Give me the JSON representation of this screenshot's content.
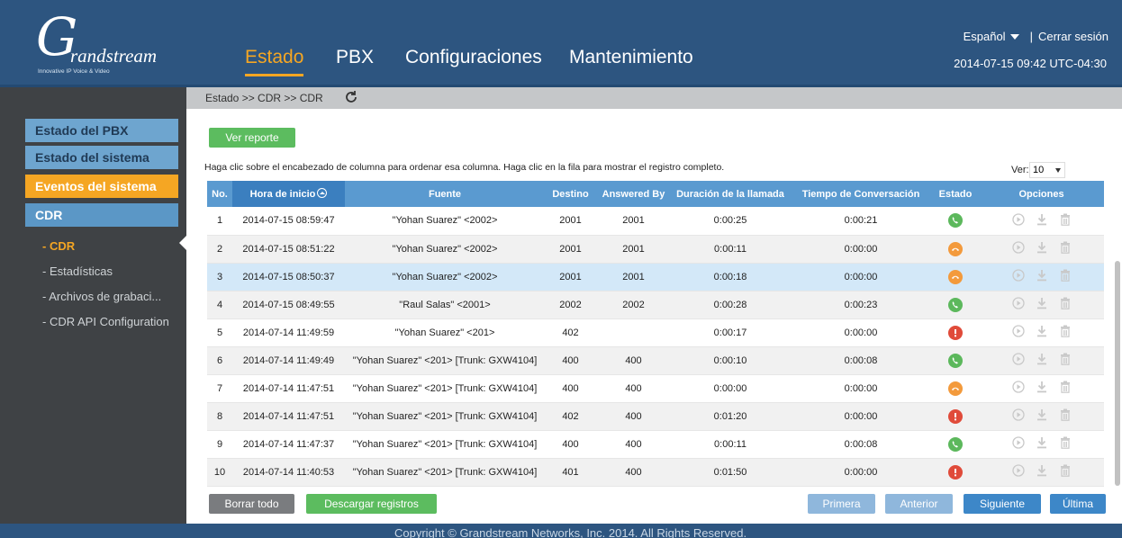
{
  "header": {
    "brand_letter": "G",
    "brand_name": "randstream",
    "brand_tagline": "Innovative IP Voice & Video",
    "nav": [
      {
        "label": "Estado",
        "active": true
      },
      {
        "label": "PBX",
        "active": false
      },
      {
        "label": "Configuraciones",
        "active": false
      },
      {
        "label": "Mantenimiento",
        "active": false
      }
    ],
    "language": "Español",
    "separator": "|",
    "logout": "Cerrar sesión",
    "datetime": "2014-07-15 09:42 UTC-04:30"
  },
  "sidebar": {
    "main_items": [
      {
        "label": "Estado del PBX"
      },
      {
        "label": "Estado del sistema"
      },
      {
        "label": "Eventos del sistema"
      },
      {
        "label": "CDR"
      }
    ],
    "sub_items": [
      {
        "label": "- CDR",
        "active": true
      },
      {
        "label": "- Estadísticas",
        "active": false
      },
      {
        "label": "- Archivos de grabaci...",
        "active": false
      },
      {
        "label": "- CDR API Configuration",
        "active": false
      }
    ]
  },
  "breadcrumb": "Estado >> CDR >> CDR",
  "toolbar": {
    "view_report": "Ver reporte",
    "hint": "Haga clic sobre el encabezado de columna para ordenar esa columna. Haga clic en la fila para mostrar el registro completo.",
    "ver_label": "Ver:",
    "ver_value": "10"
  },
  "table": {
    "columns": [
      "No.",
      "Hora de inicio",
      "Fuente",
      "Destino",
      "Answered By",
      "Duración de la llamada",
      "Tiempo de Conversación",
      "Estado",
      "Opciones"
    ],
    "rows": [
      {
        "no": "1",
        "start": "2014-07-15 08:59:47",
        "source": "\"Yohan Suarez\" <2002>",
        "dest": "2001",
        "answered_by": "2001",
        "duration": "0:00:25",
        "talk": "0:00:21",
        "status": "answered"
      },
      {
        "no": "2",
        "start": "2014-07-15 08:51:22",
        "source": "\"Yohan Suarez\" <2002>",
        "dest": "2001",
        "answered_by": "2001",
        "duration": "0:00:11",
        "talk": "0:00:00",
        "status": "noanswer"
      },
      {
        "no": "3",
        "start": "2014-07-15 08:50:37",
        "source": "\"Yohan Suarez\" <2002>",
        "dest": "2001",
        "answered_by": "2001",
        "duration": "0:00:18",
        "talk": "0:00:00",
        "status": "noanswer"
      },
      {
        "no": "4",
        "start": "2014-07-15 08:49:55",
        "source": "\"Raul Salas\" <2001>",
        "dest": "2002",
        "answered_by": "2002",
        "duration": "0:00:28",
        "talk": "0:00:23",
        "status": "answered"
      },
      {
        "no": "5",
        "start": "2014-07-14 11:49:59",
        "source": "\"Yohan Suarez\" <201>",
        "dest": "402",
        "answered_by": "",
        "duration": "0:00:17",
        "talk": "0:00:00",
        "status": "failed"
      },
      {
        "no": "6",
        "start": "2014-07-14 11:49:49",
        "source": "\"Yohan Suarez\" <201> [Trunk: GXW4104]",
        "dest": "400",
        "answered_by": "400",
        "duration": "0:00:10",
        "talk": "0:00:08",
        "status": "answered"
      },
      {
        "no": "7",
        "start": "2014-07-14 11:47:51",
        "source": "\"Yohan Suarez\" <201> [Trunk: GXW4104]",
        "dest": "400",
        "answered_by": "400",
        "duration": "0:00:00",
        "talk": "0:00:00",
        "status": "noanswer"
      },
      {
        "no": "8",
        "start": "2014-07-14 11:47:51",
        "source": "\"Yohan Suarez\" <201> [Trunk: GXW4104]",
        "dest": "402",
        "answered_by": "400",
        "duration": "0:01:20",
        "talk": "0:00:00",
        "status": "failed"
      },
      {
        "no": "9",
        "start": "2014-07-14 11:47:37",
        "source": "\"Yohan Suarez\" <201> [Trunk: GXW4104]",
        "dest": "400",
        "answered_by": "400",
        "duration": "0:00:11",
        "talk": "0:00:08",
        "status": "answered"
      },
      {
        "no": "10",
        "start": "2014-07-14 11:40:53",
        "source": "\"Yohan Suarez\" <201> [Trunk: GXW4104]",
        "dest": "401",
        "answered_by": "400",
        "duration": "0:01:50",
        "talk": "0:00:00",
        "status": "failed"
      }
    ]
  },
  "actions": {
    "delete_all": "Borrar todo",
    "download": "Descargar registros",
    "first": "Primera",
    "previous": "Anterior",
    "next": "Siguiente",
    "last": "Última"
  },
  "footer": "Copyright © Grandstream Networks, Inc. 2014. All Rights Reserved.",
  "colors": {
    "header_bg": "#2d5580",
    "accent_orange": "#f5a623",
    "table_header": "#5a9ad0",
    "answered": "#5cb85c",
    "noanswer": "#f39a3c",
    "failed": "#e04b3a"
  }
}
